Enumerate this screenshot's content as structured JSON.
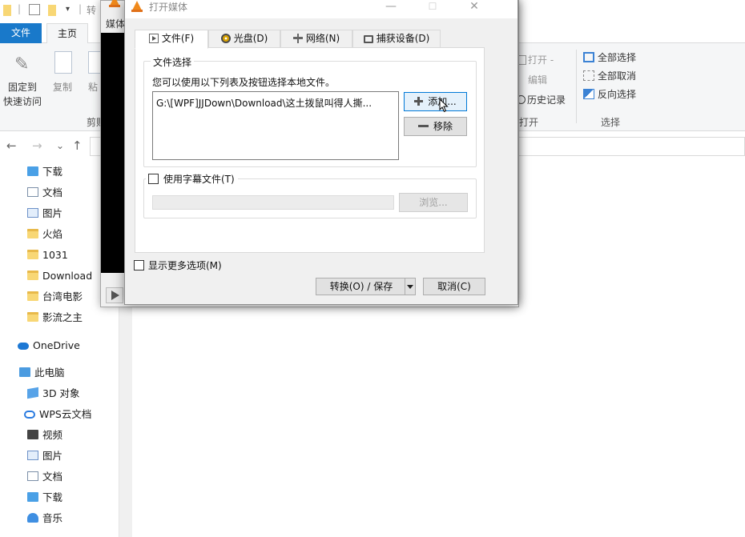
{
  "explorer": {
    "qat_title": "转",
    "ribbon_tabs": {
      "file": "文件",
      "home": "主页"
    },
    "ribbon": {
      "pin_label_line1": "固定到",
      "pin_label_line2": "快速访问",
      "copy_label": "复制",
      "paste_label": "粘",
      "clipboard_group": "剪贴",
      "open_label": "打开",
      "edit_label": "编辑",
      "history_label": "历史记录",
      "open_group": "打开",
      "select_all": "全部选择",
      "select_none": "全部取消",
      "invert_select": "反向选择",
      "select_group": "选择"
    },
    "nav": {
      "back": "←",
      "forward": "→",
      "recent": "⌄",
      "up": "↑"
    },
    "tree": [
      {
        "label": "下载",
        "icon": "download-folder-icon"
      },
      {
        "label": "文档",
        "icon": "documents-icon"
      },
      {
        "label": "图片",
        "icon": "pictures-icon"
      },
      {
        "label": "火焰",
        "icon": "folder-icon"
      },
      {
        "label": "1031",
        "icon": "folder-icon"
      },
      {
        "label": "Download",
        "icon": "folder-icon"
      },
      {
        "label": "台湾电影",
        "icon": "folder-icon"
      },
      {
        "label": "影流之主",
        "icon": "folder-icon"
      },
      {
        "label": "OneDrive",
        "icon": "onedrive-icon"
      },
      {
        "label": "此电脑",
        "icon": "this-pc-icon"
      },
      {
        "label": "3D 对象",
        "icon": "3d-objects-icon"
      },
      {
        "label": "WPS云文档",
        "icon": "wps-cloud-icon"
      },
      {
        "label": "视频",
        "icon": "videos-icon"
      },
      {
        "label": "图片",
        "icon": "pictures-icon"
      },
      {
        "label": "文档",
        "icon": "documents-icon"
      },
      {
        "label": "下载",
        "icon": "download-folder-icon"
      },
      {
        "label": "音乐",
        "icon": "music-icon"
      }
    ]
  },
  "vlc_main": {
    "menu_media": "媒体"
  },
  "dialog": {
    "title": "打开媒体",
    "titlebar_buttons": {
      "minimize": "—",
      "maximize": "☐",
      "close": "✕"
    },
    "tabs": [
      {
        "label": "文件(F)",
        "icon": "file-icon",
        "active": true
      },
      {
        "label": "光盘(D)",
        "icon": "disc-icon",
        "active": false
      },
      {
        "label": "网络(N)",
        "icon": "network-icon",
        "active": false
      },
      {
        "label": "捕获设备(D)",
        "icon": "capture-device-icon",
        "active": false
      }
    ],
    "file_selection": {
      "group_title": "文件选择",
      "hint": "您可以使用以下列表及按钮选择本地文件。",
      "files": [
        "G:\\[WPF]JJDown\\Download\\这土拨鼠叫得人撕..."
      ],
      "add_button": "添加...",
      "remove_button": "移除"
    },
    "subtitle": {
      "checkbox_label": "使用字幕文件(T)",
      "checked": false,
      "path_value": "",
      "browse_button": "浏览..."
    },
    "more_options": {
      "label": "显示更多选项(M)",
      "checked": false
    },
    "convert_button": "转换(O) / 保存",
    "cancel_button": "取消(C)"
  }
}
